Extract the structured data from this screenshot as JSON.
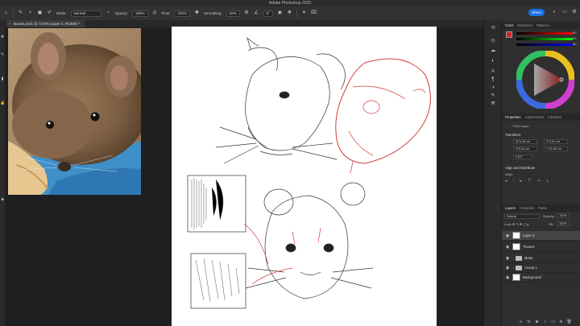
{
  "app": {
    "title": "Adobe Photoshop 2025"
  },
  "options_bar": {
    "mode_label": "Mode:",
    "mode_value": "Normal",
    "opacity_label": "Opacity:",
    "opacity_value": "100%",
    "flow_label": "Flow:",
    "flow_value": "100%",
    "smoothing_label": "Smoothing:",
    "smoothing_value": "20%",
    "angle_value": "0°",
    "share_label": "Share"
  },
  "document_tab": {
    "label": "Mouse.psdc @ 73.8% (Layer 3, RGB/8) *"
  },
  "panels": {
    "color_tabs": [
      "Color",
      "Swatches",
      "Patterns"
    ],
    "color_values": [
      "60",
      "60",
      "80"
    ],
    "properties_tabs": [
      "Properties",
      "Adjustments",
      "Libraries"
    ],
    "pixel_layer_label": "Pixel Layer",
    "transform_label": "Transform",
    "w_value": "W  5.26 cm",
    "h_value": "H  5.44 cm",
    "x_value": "X  5.21 cm",
    "y_value": "Y  11.48 cm",
    "angle_value": "0.00°",
    "align_label": "Align and Distribute",
    "align_sub": "Align:"
  },
  "layers": {
    "tabs": [
      "Layers",
      "Channels",
      "Paths"
    ],
    "blend_mode": "Normal",
    "opacity_label": "Opacity:",
    "opacity_value": "100%",
    "lock_label": "Lock:",
    "fill_label": "Fill:",
    "fill_value": "100%",
    "rows": [
      {
        "name": "Layer 3",
        "kind": "pixel",
        "selected": true
      },
      {
        "name": "Tissues",
        "kind": "pixel",
        "selected": false
      },
      {
        "name": "Bone",
        "kind": "group",
        "selected": false
      },
      {
        "name": "Group 1",
        "kind": "group",
        "selected": false
      },
      {
        "name": "Background",
        "kind": "pixel",
        "selected": false
      }
    ]
  },
  "colors": {
    "accent": "#1473e6",
    "foreground_swatch": "#cc2222",
    "background_swatch": "#ffffff",
    "sketch_red": "#d23c3c"
  },
  "icons": [
    "home-icon",
    "brush-tool-icon",
    "brush-settings-icon",
    "airbrush-icon",
    "search-icon",
    "learn-icon",
    "cloud-icon",
    "history-icon",
    "adjustments-icon",
    "paragraph-icon",
    "character-icon",
    "eye-icon",
    "folder-icon",
    "lock-icon",
    "trash-icon",
    "add-layer-icon"
  ]
}
